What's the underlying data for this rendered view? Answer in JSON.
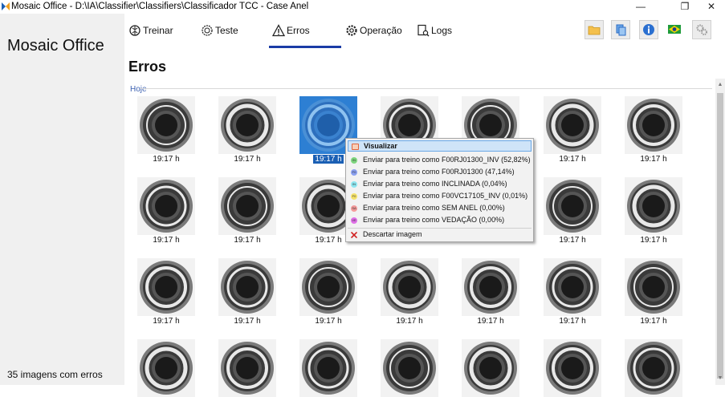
{
  "window": {
    "title": "Mosaic Office - D:\\IA\\Classifier\\Classifiers\\Classificador TCC - Case Anel",
    "minimize": "—",
    "maximize": "❐",
    "close": "✕"
  },
  "sidebar": {
    "app_name": "Mosaic Office",
    "footer_status": "35 imagens com erros"
  },
  "nav": {
    "tabs": [
      {
        "label": "Treinar",
        "icon": "brain-icon"
      },
      {
        "label": "Teste",
        "icon": "gear-brain-icon"
      },
      {
        "label": "Erros",
        "icon": "warning-icon",
        "active": true
      },
      {
        "label": "Operação",
        "icon": "gear-icon"
      },
      {
        "label": "Logs",
        "icon": "document-search-icon"
      }
    ]
  },
  "toolbar": {
    "icons": [
      "folder-icon",
      "copy-icon",
      "info-icon",
      "brazil-flag-icon",
      "settings-icon"
    ]
  },
  "main": {
    "page_title": "Erros",
    "section_label": "Hoje",
    "timestamps": [
      "19:17 h",
      "19:17 h",
      "19:17 h",
      "19:17 h",
      "19:17 h",
      "19:17 h",
      "19:17 h",
      "19:17 h",
      "19:17 h",
      "19:17 h",
      "19:17 h",
      "19:17 h",
      "19:17 h",
      "19:17 h",
      "19:17 h",
      "19:17 h",
      "19:17 h",
      "19:17 h",
      "19:17 h",
      "19:17 h",
      "19:17 h"
    ],
    "selected_index": 2
  },
  "context_menu": {
    "items": [
      {
        "label": "Visualizar",
        "badge": "",
        "color": "#e0643c"
      },
      {
        "label": "Enviar para treino como F00RJ01300_INV (52,82%)",
        "badge": "IN",
        "color": "#7ed67e"
      },
      {
        "label": "Enviar para treino como F00RJ01300 (47,14%)",
        "badge": "F0",
        "color": "#8aa0f0"
      },
      {
        "label": "Enviar para treino como INCLINADA (0,04%)",
        "badge": "IN",
        "color": "#8ee6f0"
      },
      {
        "label": "Enviar para treino como F00VC17105_INV (0,01%)",
        "badge": "F0",
        "color": "#f5e26a"
      },
      {
        "label": "Enviar para treino como SEM ANEL (0,00%)",
        "badge": "SA",
        "color": "#f39a9a"
      },
      {
        "label": "Enviar para treino como VEDAÇÃO (0,00%)",
        "badge": "VE",
        "color": "#e070e8"
      },
      {
        "label": "Descartar imagem",
        "badge": "",
        "color": "#d02020"
      }
    ]
  }
}
